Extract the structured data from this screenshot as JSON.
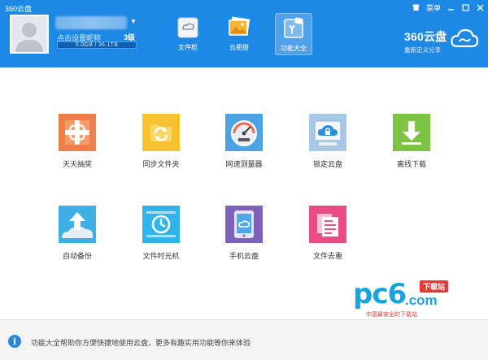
{
  "window": {
    "title": "360云盘",
    "menu_label": "菜单",
    "controls": [
      "skin-icon",
      "menu-label",
      "minimize-icon",
      "maximize-icon",
      "close-icon"
    ]
  },
  "user": {
    "nickname_prompt": "点击设置昵称",
    "level": "3级",
    "quota": "0.0GB / 36.1TB",
    "quota_used_fraction": 0.0
  },
  "nav": {
    "tabs": [
      {
        "label": "文件柜",
        "icon": "file-cabinet-icon",
        "active": false
      },
      {
        "label": "云相册",
        "icon": "photo-album-icon",
        "active": false
      },
      {
        "label": "功能大全",
        "icon": "toolbox-icon",
        "active": true
      }
    ]
  },
  "brand": {
    "name": "360云盘",
    "slogan": "重新定义分享",
    "icon": "cloud-logo-icon"
  },
  "features": [
    {
      "label": "天天抽奖",
      "icon": "daily-lottery-icon",
      "color": "#ef7e4a"
    },
    {
      "label": "同步文件夹",
      "icon": "sync-folder-icon",
      "color": "#f6c22f"
    },
    {
      "label": "网速测量器",
      "icon": "speed-meter-icon",
      "color": "#4da3e3"
    },
    {
      "label": "锁定云盘",
      "icon": "lock-cloud-icon",
      "color": "#a7c9e6"
    },
    {
      "label": "离线下载",
      "icon": "offline-download-icon",
      "color": "#7dc344"
    },
    {
      "label": "自动备份",
      "icon": "auto-backup-icon",
      "color": "#3fb0e6"
    },
    {
      "label": "文件时光机",
      "icon": "time-machine-icon",
      "color": "#31b4ec"
    },
    {
      "label": "手机云盘",
      "icon": "mobile-cloud-icon",
      "color": "#7d62b9"
    },
    {
      "label": "文件去重",
      "icon": "dedupe-icon",
      "color": "#ea4c86"
    }
  ],
  "watermark": {
    "big": "pc6",
    "com": ".com",
    "tag": "下载站",
    "sub": "中国最安全的下载站"
  },
  "footer": {
    "text": "功能大全帮助你方便快捷地使用云盘，更多有趣实用功能等你来体验",
    "icon": "info-icon"
  }
}
